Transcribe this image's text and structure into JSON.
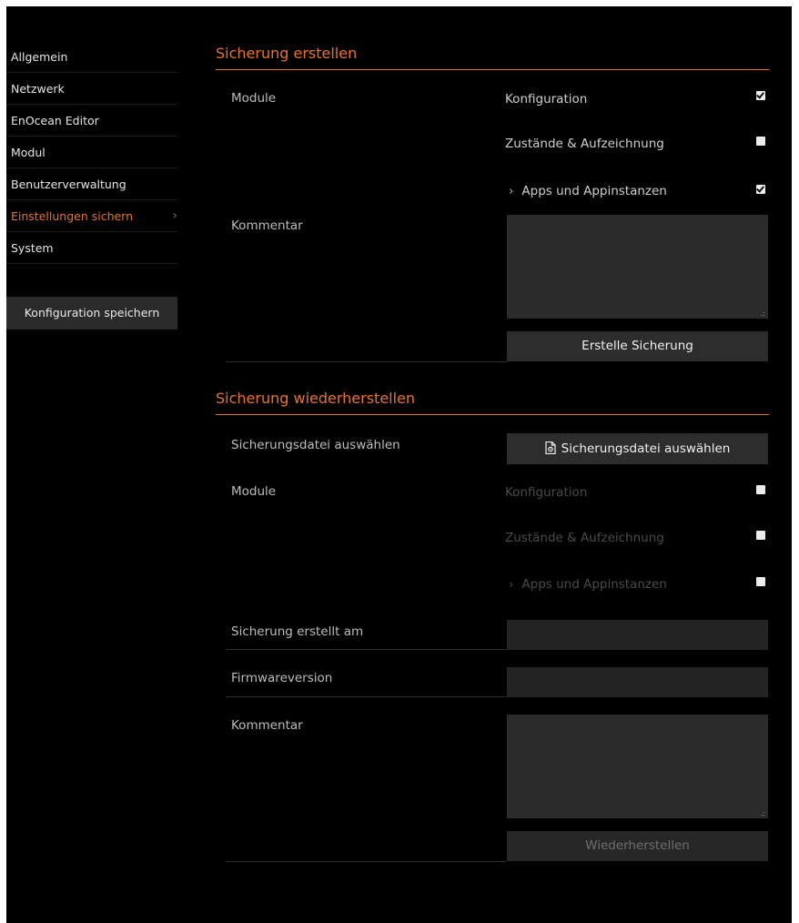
{
  "sidebar": {
    "items": [
      {
        "label": "Allgemein"
      },
      {
        "label": "Netzwerk"
      },
      {
        "label": "EnOcean Editor"
      },
      {
        "label": "Modul"
      },
      {
        "label": "Benutzerverwaltung"
      },
      {
        "label": "Einstellungen sichern",
        "active": true
      },
      {
        "label": "System"
      }
    ],
    "chevron": "›",
    "save_button": "Konfiguration speichern"
  },
  "backup": {
    "title": "Sicherung erstellen",
    "modules_label": "Module",
    "options": [
      {
        "label": "Konfiguration",
        "checked": true
      },
      {
        "label": "Zustände & Aufzeichnung",
        "checked": false
      },
      {
        "label": "Apps und Appinstanzen",
        "checked": true,
        "expandable": true
      }
    ],
    "expand_icon": "›",
    "comment_label": "Kommentar",
    "comment_value": "",
    "create_button": "Erstelle Sicherung"
  },
  "restore": {
    "title": "Sicherung wiederherstellen",
    "file_label": "Sicherungsdatei auswählen",
    "file_button": "Sicherungsdatei auswählen",
    "modules_label": "Module",
    "options": [
      {
        "label": "Konfiguration",
        "checked": false
      },
      {
        "label": "Zustände & Aufzeichnung",
        "checked": false
      },
      {
        "label": "Apps und Appinstanzen",
        "checked": false,
        "expandable": true
      }
    ],
    "expand_icon": "›",
    "created_label": "Sicherung erstellt am",
    "created_value": "",
    "firmware_label": "Firmwareversion",
    "firmware_value": "",
    "comment_label": "Kommentar",
    "comment_value": "",
    "restore_button": "Wiederherstellen"
  },
  "colors": {
    "accent": "#e8732a",
    "background": "#000000",
    "panel": "#2b2b2b"
  },
  "icons": {
    "file": "file-backup-icon",
    "resize": "resize-grip-icon"
  }
}
